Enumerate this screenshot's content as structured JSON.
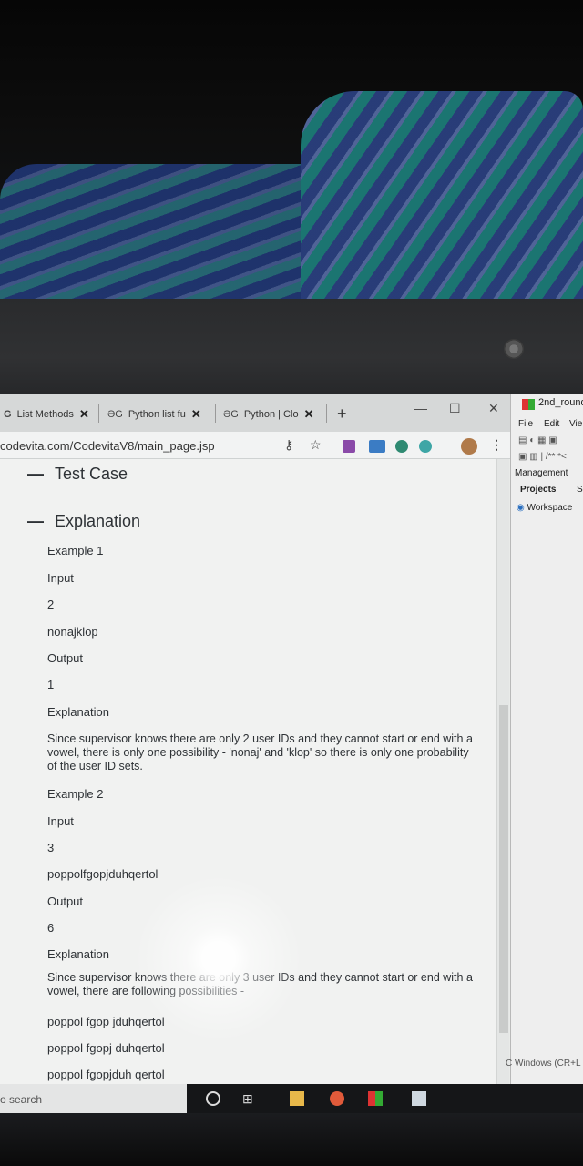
{
  "browser": {
    "tabs": [
      {
        "label": "List Methods"
      },
      {
        "label": "Python list fu"
      },
      {
        "label": "Python | Clo"
      }
    ],
    "new_tab": "+",
    "url": "codevita.com/CodevitaV8/main_page.jsp"
  },
  "page": {
    "test_case_heading": "Test Case",
    "explanation_heading": "Explanation",
    "example1": {
      "title": "Example 1",
      "input_label": "Input",
      "input_n": "2",
      "input_s": "nonajklop",
      "output_label": "Output",
      "output_value": "1",
      "explanation_label": "Explanation",
      "explanation_text": "Since supervisor knows there are only 2 user IDs and they cannot start or end with a vowel, there is only one possibility - 'nonaj' and 'klop' so there is only one probability of the user ID sets."
    },
    "example2": {
      "title": "Example 2",
      "input_label": "Input",
      "input_n": "3",
      "input_s": "poppolfgopjduhqertol",
      "output_label": "Output",
      "output_value": "6",
      "explanation_label": "Explanation",
      "explanation_text": "Since supervisor knows there are only 3 user IDs and they cannot start or end with a vowel, there are following possibilities -",
      "possibilities": [
        "poppol fgop jduhqertol",
        "poppol fgopj duhqertol",
        "poppol fgopjduh qertol"
      ]
    }
  },
  "ide": {
    "title": "2nd_round",
    "menu": [
      "File",
      "Edit",
      "Vie"
    ],
    "management_label": "Management",
    "tab_projects": "Projects",
    "tab_s": "S",
    "workspace": "Workspace",
    "status": "C Windows (CR+L"
  },
  "taskbar": {
    "search_placeholder": "o search"
  }
}
